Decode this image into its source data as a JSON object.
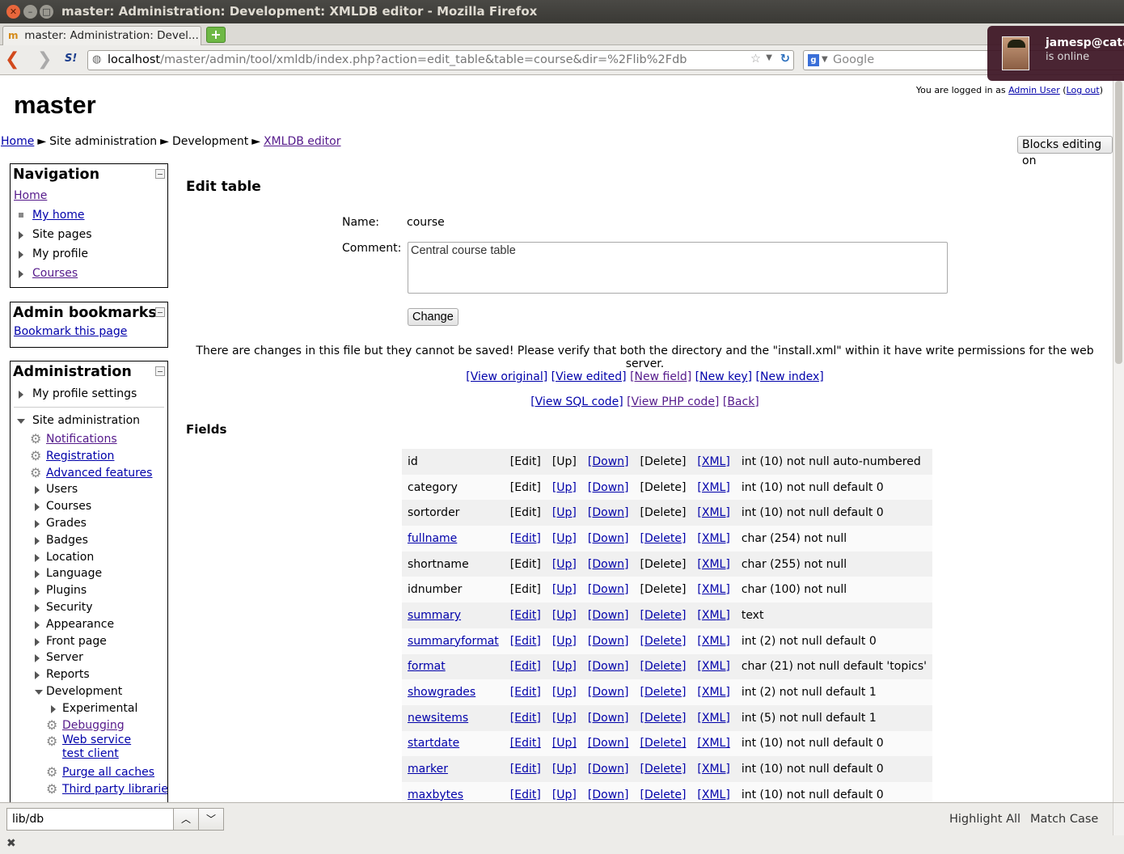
{
  "window": {
    "title": "master: Administration: Development: XMLDB editor - Mozilla Firefox",
    "tab_title": "master: Administration: Devel..."
  },
  "navbar": {
    "url_host": "localhost",
    "url_path": "/master/admin/tool/xmldb/index.php?action=edit_table&table=course&dir=%2Flib%2Fdb",
    "search_placeholder": "Google"
  },
  "notification": {
    "user": "jamesp@catal",
    "status": "is online"
  },
  "header": {
    "login_prefix": "You are logged in as ",
    "login_user": "Admin User",
    "logout": "Log out",
    "site_name": "master",
    "blocks_editing": "Blocks editing on"
  },
  "breadcrumb": {
    "home": "Home",
    "site_admin": "Site administration",
    "development": "Development",
    "xmldb": "XMLDB editor",
    "sep": "►"
  },
  "navigation": {
    "title": "Navigation",
    "home": "Home",
    "items": [
      "My home",
      "Site pages",
      "My profile",
      "Courses"
    ]
  },
  "bookmarks": {
    "title": "Admin bookmarks",
    "link": "Bookmark this page"
  },
  "administration": {
    "title": "Administration",
    "profile_settings": "My profile settings",
    "site_admin": "Site administration",
    "links": [
      "Notifications",
      "Registration",
      "Advanced features"
    ],
    "sections": [
      "Users",
      "Courses",
      "Grades",
      "Badges",
      "Location",
      "Language",
      "Plugins",
      "Security",
      "Appearance",
      "Front page",
      "Server",
      "Reports"
    ],
    "development": "Development",
    "experimental": "Experimental",
    "dev_links": [
      "Debugging",
      "Web service test client",
      "Purge all caches",
      "Third party libraries"
    ]
  },
  "edit_table": {
    "title": "Edit table",
    "name_label": "Name:",
    "name_value": "course",
    "comment_label": "Comment:",
    "comment_value": "Central course table",
    "change_button": "Change",
    "warning": "There are changes in this file but they cannot be saved! Please verify that both the directory and the \"install.xml\" within it have write permissions for the web server.",
    "actions1": [
      "[View original]",
      "[View edited]",
      "[New field]",
      "[New key]",
      "[New index]"
    ],
    "actions2": [
      "[View SQL code]",
      "[View PHP code]",
      "[Back]"
    ],
    "fields_title": "Fields"
  },
  "fields": [
    {
      "name": "id",
      "linked": false,
      "edit_link": false,
      "up_link": false,
      "delete_link": false,
      "type": "int (10) not null auto-numbered"
    },
    {
      "name": "category",
      "linked": false,
      "edit_link": false,
      "up_link": true,
      "delete_link": false,
      "type": "int (10) not null default 0"
    },
    {
      "name": "sortorder",
      "linked": false,
      "edit_link": false,
      "up_link": true,
      "delete_link": false,
      "type": "int (10) not null default 0"
    },
    {
      "name": "fullname",
      "linked": true,
      "edit_link": true,
      "up_link": true,
      "delete_link": true,
      "type": "char (254) not null"
    },
    {
      "name": "shortname",
      "linked": false,
      "edit_link": false,
      "up_link": true,
      "delete_link": false,
      "type": "char (255) not null"
    },
    {
      "name": "idnumber",
      "linked": false,
      "edit_link": false,
      "up_link": true,
      "delete_link": false,
      "type": "char (100) not null"
    },
    {
      "name": "summary",
      "linked": true,
      "edit_link": true,
      "up_link": true,
      "delete_link": true,
      "type": "text"
    },
    {
      "name": "summaryformat",
      "linked": true,
      "edit_link": true,
      "up_link": true,
      "delete_link": true,
      "type": "int (2) not null default 0"
    },
    {
      "name": "format",
      "linked": true,
      "edit_link": true,
      "up_link": true,
      "delete_link": true,
      "type": "char (21) not null default 'topics'"
    },
    {
      "name": "showgrades",
      "linked": true,
      "edit_link": true,
      "up_link": true,
      "delete_link": true,
      "type": "int (2) not null default 1"
    },
    {
      "name": "newsitems",
      "linked": true,
      "edit_link": true,
      "up_link": true,
      "delete_link": true,
      "type": "int (5) not null default 1"
    },
    {
      "name": "startdate",
      "linked": true,
      "edit_link": true,
      "up_link": true,
      "delete_link": true,
      "type": "int (10) not null default 0"
    },
    {
      "name": "marker",
      "linked": true,
      "edit_link": true,
      "up_link": true,
      "delete_link": true,
      "type": "int (10) not null default 0"
    },
    {
      "name": "maxbytes",
      "linked": true,
      "edit_link": true,
      "up_link": true,
      "delete_link": true,
      "type": "int (10) not null default 0"
    }
  ],
  "field_actions": {
    "edit": "[Edit]",
    "up": "[Up]",
    "down": "[Down]",
    "delete": "[Delete]",
    "xml": "[XML]"
  },
  "findbar": {
    "query": "lib/db",
    "highlight_all": "Highlight All",
    "match_case": "Match Case"
  }
}
